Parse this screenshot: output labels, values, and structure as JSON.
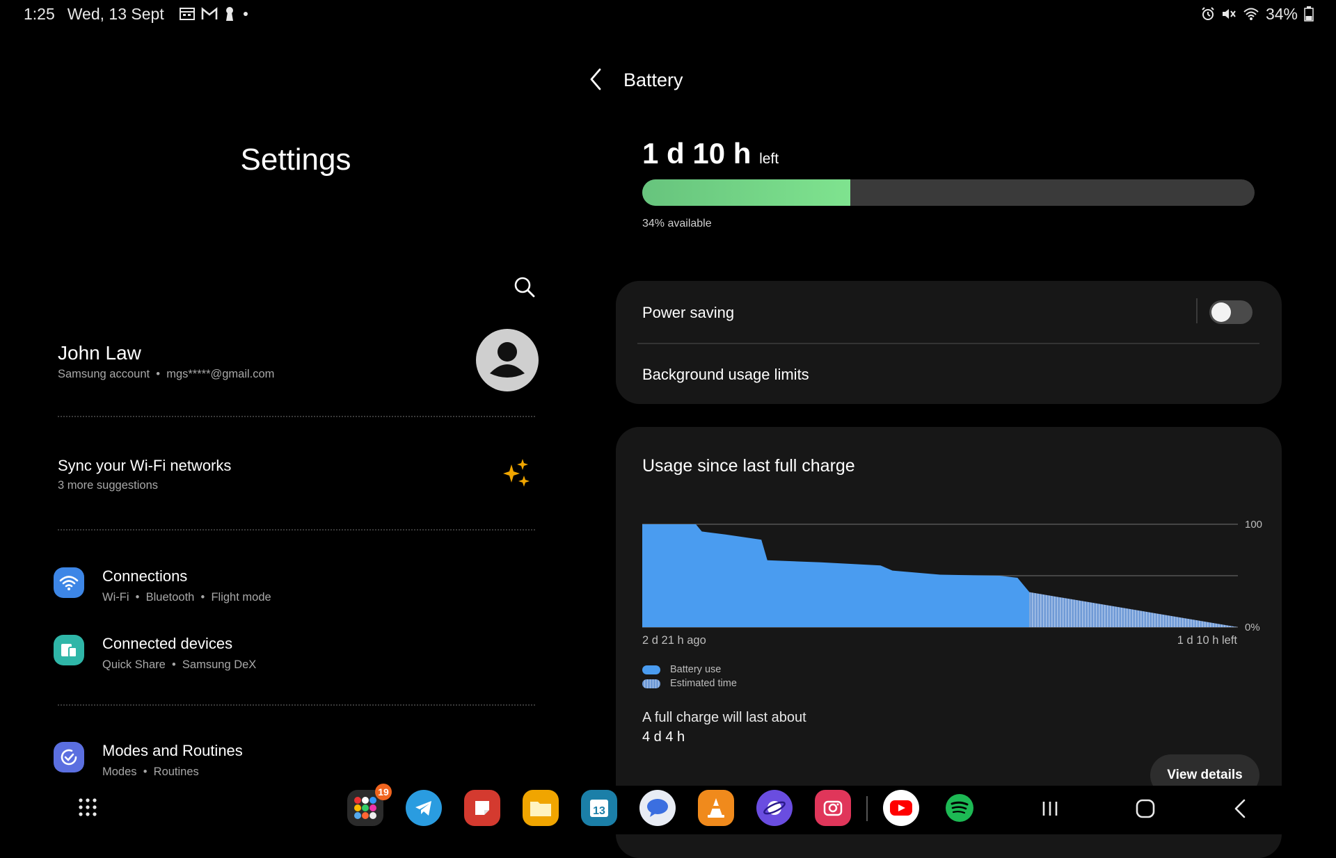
{
  "status_bar": {
    "time": "1:25",
    "date": "Wed, 13 Sept",
    "notif_icons": [
      "calendar-icon",
      "gmail-icon",
      "keyhole-icon",
      "dot-icon"
    ],
    "right_icons": [
      "alarm-icon",
      "mute-icon",
      "wifi-icon"
    ],
    "battery": "34%"
  },
  "left": {
    "title": "Settings",
    "profile": {
      "name": "John Law",
      "account": "Samsung account",
      "email": "mgs*****@gmail.com"
    },
    "suggestion": {
      "title": "Sync your Wi-Fi networks",
      "subtitle": "3 more suggestions"
    },
    "categories": [
      {
        "title": "Connections",
        "sub": [
          "Wi-Fi",
          "Bluetooth",
          "Flight mode"
        ],
        "icon": "wifi-icon",
        "color": "#3d86e6"
      },
      {
        "title": "Connected devices",
        "sub": [
          "Quick Share",
          "Samsung DeX"
        ],
        "icon": "devices-icon",
        "color": "#2fb6a8"
      },
      {
        "title": "Modes and Routines",
        "sub": [
          "Modes",
          "Routines"
        ],
        "icon": "routine-check-icon",
        "color": "#5b6fe0"
      }
    ]
  },
  "right": {
    "title": "Battery",
    "time_left": "1 d 10 h",
    "time_left_suffix": "left",
    "battery_percent": 34,
    "available": "34% available",
    "power_saving": {
      "label": "Power saving",
      "enabled": false
    },
    "background_limits": "Background usage limits",
    "usage_title": "Usage since last full charge",
    "full_charge_label": "A full charge will last about",
    "full_charge_value": "4 d 4 h",
    "view_details": "View details"
  },
  "chart_data": {
    "type": "area",
    "title": "Usage since last full charge",
    "ylim": [
      0,
      100
    ],
    "y_ticks": [
      "100",
      "0%"
    ],
    "x_labels": [
      "2 d 21 h ago",
      "1 d 10 h left"
    ],
    "grid": true,
    "series": [
      {
        "name": "Battery use",
        "color": "#4a9cf0",
        "x": [
          0,
          0.09,
          0.1,
          0.14,
          0.2,
          0.21,
          0.3,
          0.4,
          0.42,
          0.5,
          0.6,
          0.63,
          0.65
        ],
        "y": [
          100,
          100,
          93,
          90,
          85,
          65,
          63,
          60,
          55,
          51,
          50,
          48,
          34
        ]
      },
      {
        "name": "Estimated time",
        "color": "#7da4d6",
        "x": [
          0.65,
          1.0
        ],
        "y": [
          34,
          0
        ]
      }
    ],
    "legend": [
      "Battery use",
      "Estimated time"
    ]
  },
  "dock": {
    "apps": [
      {
        "name": "apps-folder",
        "color": "#2b2b2b",
        "badge": "19"
      },
      {
        "name": "telegram",
        "color": "#2a9ce0"
      },
      {
        "name": "notes-red",
        "color": "#d43a2f"
      },
      {
        "name": "my-files",
        "color": "#f0a500"
      },
      {
        "name": "calendar",
        "color": "#1b7fa8",
        "label": "13"
      },
      {
        "name": "messages",
        "color": "#e8ecf4"
      },
      {
        "name": "vlc",
        "color": "#f08a1c"
      },
      {
        "name": "samsung-internet",
        "color": "#6a4de0"
      },
      {
        "name": "camera",
        "color": "#e0365a"
      },
      {
        "name": "youtube",
        "color": "#ffffff"
      },
      {
        "name": "spotify",
        "color": "#1db954"
      }
    ]
  }
}
